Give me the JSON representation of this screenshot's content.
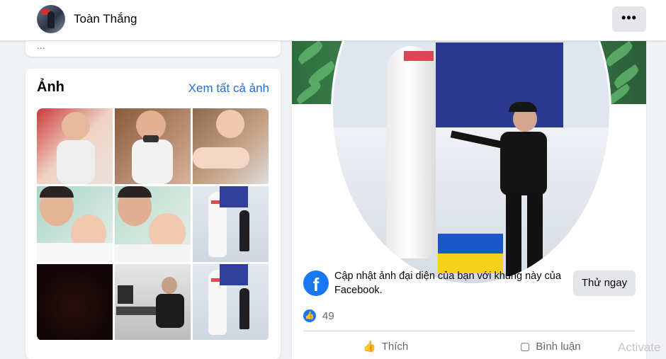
{
  "header": {
    "profile_name": "Toàn Thắng",
    "more_label": "•••"
  },
  "intro_card": {
    "cut_text": "..."
  },
  "photos": {
    "title": "Ảnh",
    "see_all": "Xem tất cả ảnh",
    "items": [
      "baby-1",
      "baby-2",
      "baby-3",
      "man-baby-1",
      "man-baby-2",
      "bowling-pin-1",
      "dark",
      "man-desk",
      "bowling-pin-2"
    ]
  },
  "post": {
    "frame_prompt": "Cập nhật ảnh đại diện của bạn với khung này của Facebook.",
    "try_button": "Thử ngay",
    "fb_logo": "f",
    "reaction_count": "49",
    "like_label": "Thích",
    "comment_label": "Bình luận"
  },
  "overlay": {
    "activate": "Activate"
  },
  "colors": {
    "accent": "#1877f2",
    "link": "#216fdb",
    "bg": "#f0f2f5"
  }
}
